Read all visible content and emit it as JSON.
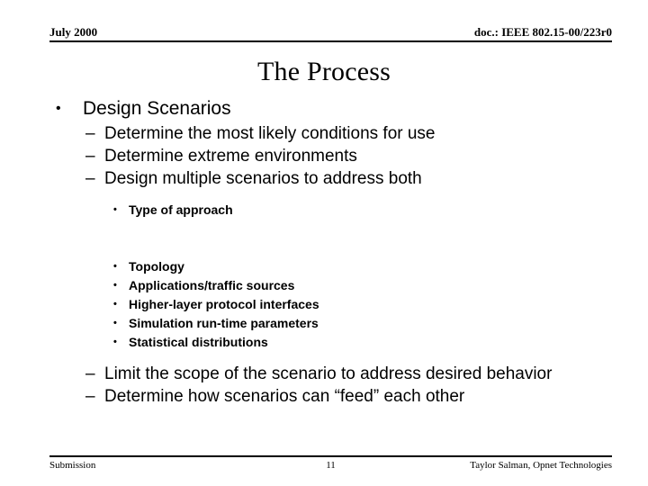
{
  "header": {
    "left": "July 2000",
    "right": "doc.: IEEE 802.15-00/223r0"
  },
  "title": "The Process",
  "body": {
    "level1": "Design Scenarios",
    "level2_first": [
      "Determine the most likely conditions for use",
      "Determine extreme environments",
      "Design multiple scenarios to address both"
    ],
    "level3_first": [
      "Type of approach"
    ],
    "level3_second": [
      "Topology",
      "Applications/traffic  sources",
      "Higher-layer protocol interfaces",
      "Simulation run-time parameters",
      "Statistical distributions"
    ],
    "level2_last": [
      "Limit the scope of the scenario to address desired behavior",
      "Determine how scenarios can “feed” each other"
    ],
    "markers": {
      "level1": "•",
      "level2": "–",
      "level3": "•"
    }
  },
  "footer": {
    "left": "Submission",
    "page": "11",
    "right": "Taylor Salman, Opnet Technologies"
  },
  "colors": {
    "text": "#000000",
    "background": "#ffffff",
    "rule": "#000000"
  }
}
